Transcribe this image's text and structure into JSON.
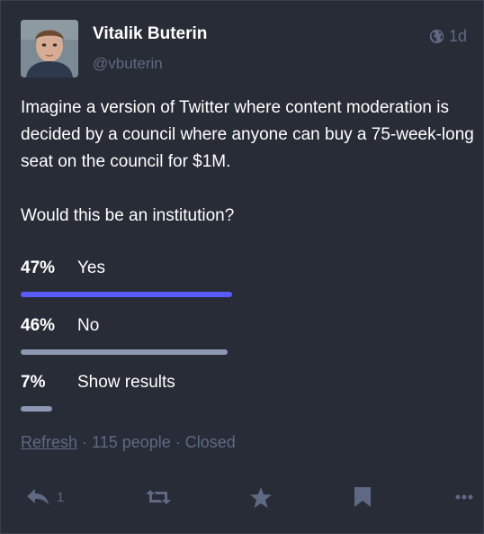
{
  "author": {
    "display_name": "Vitalik Buterin",
    "handle": "@vbuterin"
  },
  "meta": {
    "visibility_icon": "globe-icon",
    "time_ago": "1d"
  },
  "content": {
    "paragraph_1": "Imagine a version of Twitter where content moderation is decided by a council where anyone can buy a 75-week-long seat on the council for $1M.",
    "paragraph_2": "Would this be an institution?"
  },
  "poll": {
    "options": [
      {
        "percent_label": "47%",
        "label": "Yes",
        "fraction": 0.47,
        "leading": true
      },
      {
        "percent_label": "46%",
        "label": "No",
        "fraction": 0.46,
        "leading": false
      },
      {
        "percent_label": "7%",
        "label": "Show results",
        "fraction": 0.07,
        "leading": false
      }
    ],
    "refresh_label": "Refresh",
    "separator": " · ",
    "voters": "115 people",
    "status": "Closed"
  },
  "actions": {
    "reply_count": "1",
    "icons": [
      "reply-icon",
      "boost-icon",
      "star-icon",
      "bookmark-icon",
      "more-icon"
    ]
  },
  "colors": {
    "background": "#282c37",
    "muted": "#606984",
    "leading_bar": "#595aff",
    "bar": "#8c98b4"
  }
}
